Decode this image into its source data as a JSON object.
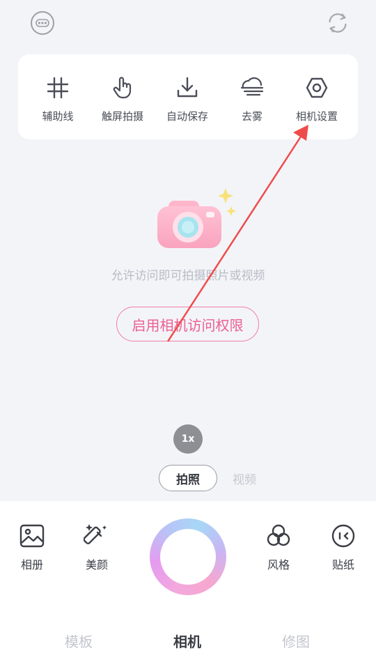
{
  "top_bar": {
    "left_icon": "more-dots-icon",
    "right_icon": "switch-camera-icon"
  },
  "settings": [
    {
      "label": "辅助线",
      "icon": "grid-icon"
    },
    {
      "label": "触屏拍摄",
      "icon": "touch-icon"
    },
    {
      "label": "自动保存",
      "icon": "download-icon"
    },
    {
      "label": "去雾",
      "icon": "dehaze-icon"
    },
    {
      "label": "相机设置",
      "icon": "hexagon-settings-icon"
    }
  ],
  "permission": {
    "message": "允许访问即可拍摄照片或视频",
    "button_label": "启用相机访问权限"
  },
  "zoom_level": "1x",
  "modes": {
    "photo": "拍照",
    "video": "视频"
  },
  "tools": {
    "album": "相册",
    "beauty": "美颜",
    "style": "风格",
    "sticker": "贴纸"
  },
  "bottom_tabs": [
    "模板",
    "相机",
    "修图"
  ],
  "colors": {
    "accent_pink": "#ec5f92",
    "annotation_arrow": "#f04b4b",
    "background": "#f3f4f8"
  }
}
